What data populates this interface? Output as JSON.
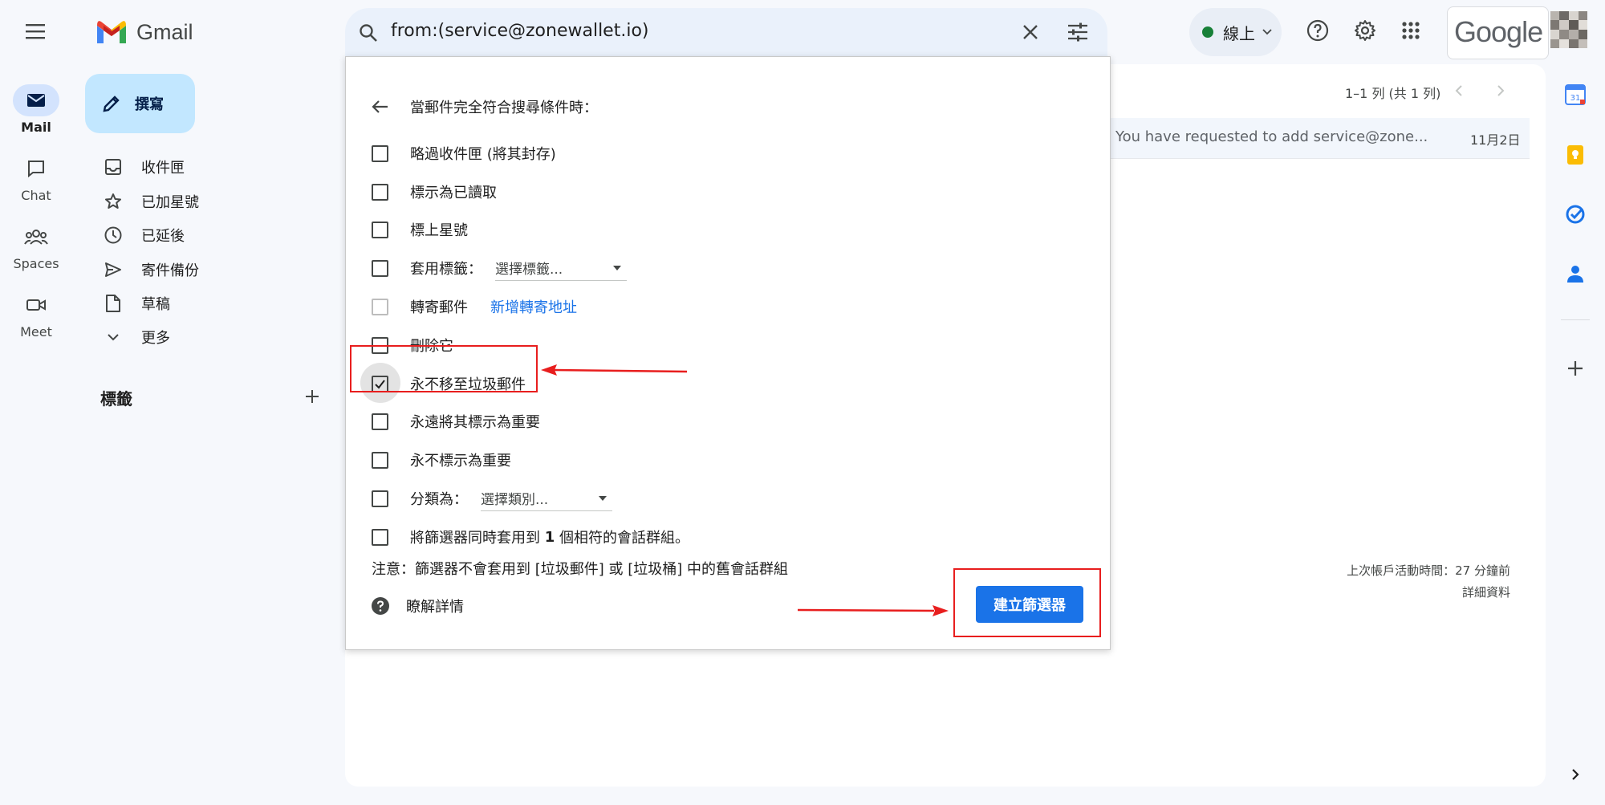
{
  "app": {
    "name": "Gmail",
    "brand_colors": [
      "#ea4335",
      "#fbbc04",
      "#34a853",
      "#4285f4"
    ]
  },
  "rail": [
    {
      "label": "Mail",
      "icon": "mail-icon",
      "active": true
    },
    {
      "label": "Chat",
      "icon": "chat-icon"
    },
    {
      "label": "Spaces",
      "icon": "spaces-icon"
    },
    {
      "label": "Meet",
      "icon": "meet-icon"
    }
  ],
  "compose": {
    "label": "撰寫"
  },
  "nav": [
    {
      "label": "收件匣",
      "icon": "inbox-icon"
    },
    {
      "label": "已加星號",
      "icon": "star-icon"
    },
    {
      "label": "已延後",
      "icon": "clock-icon"
    },
    {
      "label": "寄件備份",
      "icon": "send-icon"
    },
    {
      "label": "草稿",
      "icon": "draft-icon"
    },
    {
      "label": "更多",
      "icon": "chevron-down-icon"
    }
  ],
  "labels_section": {
    "title": "標籤",
    "add_icon": "plus-icon"
  },
  "search": {
    "query": "from:(service@zonewallet.io)"
  },
  "status": {
    "label": "線上",
    "color": "#188038"
  },
  "google_logo": "Google",
  "pagination": {
    "text": "1–1 列 (共 1 列)"
  },
  "email_row": {
    "snippet": "You have requested to add service@zone...",
    "date": "11月2日"
  },
  "footer": {
    "activity": "上次帳戶活動時間：27 分鐘前",
    "details": "詳細資料"
  },
  "filter": {
    "header": "當郵件完全符合搜尋條件時：",
    "options": {
      "skip_inbox": "略過收件匣 (將其封存)",
      "mark_read": "標示為已讀取",
      "star": "標上星號",
      "apply_label": "套用標籤：",
      "label_select": "選擇標籤...",
      "forward": "轉寄郵件",
      "forward_link": "新增轉寄地址",
      "delete": "刪除它",
      "never_spam": "永不移至垃圾郵件",
      "always_important": "永遠將其標示為重要",
      "never_important": "永不標示為重要",
      "categorize": "分類為：",
      "category_select": "選擇類別...",
      "also_apply_prefix": "將篩選器同時套用到 ",
      "also_apply_count": "1",
      "also_apply_suffix": " 個相符的會話群組。"
    },
    "never_spam_checked": true,
    "note": "注意：篩選器不會套用到 [垃圾郵件] 或 [垃圾桶] 中的舊會話群組",
    "learn_more": "瞭解詳情",
    "create_button": "建立篩選器",
    "accent_color": "#1a73e8",
    "annotation_color": "#e81e1e"
  }
}
